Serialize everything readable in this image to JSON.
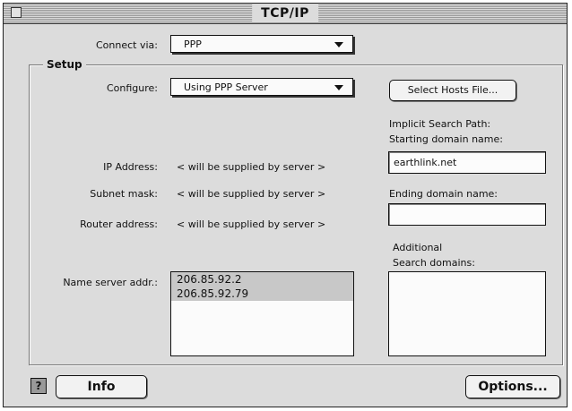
{
  "window": {
    "title": "TCP/IP"
  },
  "connect": {
    "label": "Connect via:",
    "value": "PPP"
  },
  "setup": {
    "group_label": "Setup",
    "configure_label": "Configure:",
    "configure_value": "Using PPP Server",
    "select_hosts_label": "Select Hosts File...",
    "ip_label": "IP Address:",
    "ip_value": "< will be supplied by server >",
    "subnet_label": "Subnet mask:",
    "subnet_value": "< will be supplied by server >",
    "router_label": "Router address:",
    "router_value": "< will be supplied by server >",
    "nameserver_label": "Name server addr.:",
    "nameservers": [
      "206.85.92.2",
      "206.85.92.79"
    ],
    "implicit_search_label": "Implicit Search Path:",
    "starting_domain_label": "Starting domain name:",
    "starting_domain_value": "earthlink.net",
    "ending_domain_label": "Ending domain name:",
    "ending_domain_value": "",
    "additional_label_line1": "Additional",
    "additional_label_line2": "Search domains:"
  },
  "footer": {
    "help_glyph": "?",
    "info_label": "Info",
    "options_label": "Options..."
  }
}
